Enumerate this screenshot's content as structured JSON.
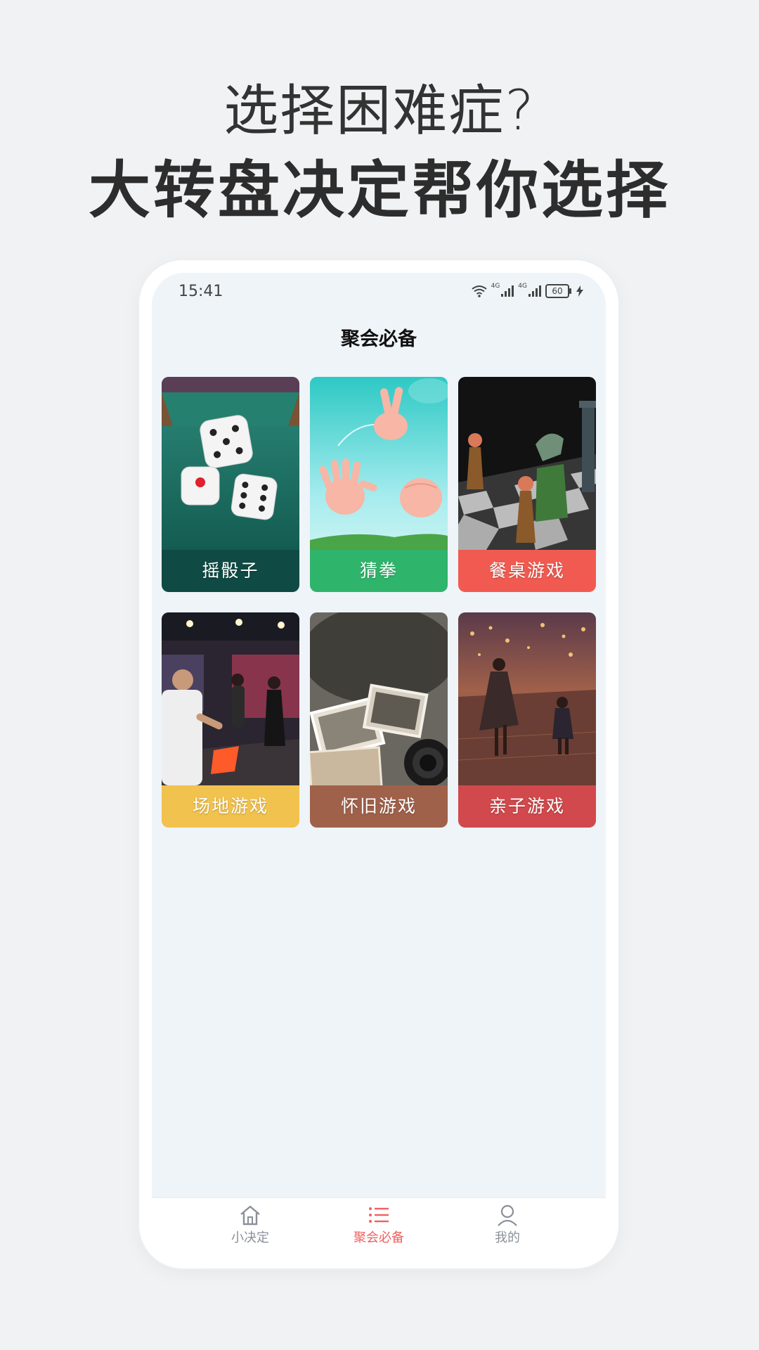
{
  "promo": {
    "line1": "选择困难症?",
    "line2": "大转盘决定帮你选择"
  },
  "status_bar": {
    "time": "15:41",
    "network1": "4G",
    "network2": "4G",
    "battery": "60"
  },
  "page": {
    "title": "聚会必备"
  },
  "cards": [
    {
      "label": "摇骰子",
      "color": "#0f4a44"
    },
    {
      "label": "猜拳",
      "color": "#2fb46b"
    },
    {
      "label": "餐桌游戏",
      "color": "#f15a50"
    },
    {
      "label": "场地游戏",
      "color": "#f2c24e"
    },
    {
      "label": "怀旧游戏",
      "color": "#a0614a"
    },
    {
      "label": "亲子游戏",
      "color": "#d1494c"
    }
  ],
  "tabbar": {
    "items": [
      {
        "label": "小决定",
        "icon": "home-icon",
        "active": false
      },
      {
        "label": "聚会必备",
        "icon": "list-icon",
        "active": true
      },
      {
        "label": "我的",
        "icon": "user-icon",
        "active": false
      }
    ],
    "active_color": "#f06060",
    "inactive_color": "#8a8f99"
  }
}
